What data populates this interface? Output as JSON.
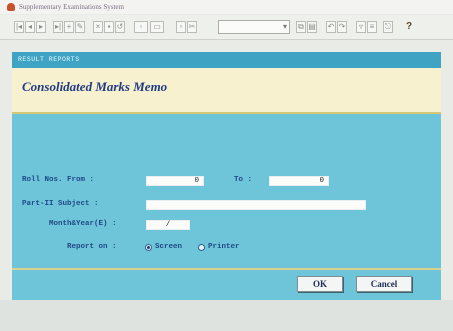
{
  "window": {
    "title": "Supplementary Examinations System"
  },
  "toolbar": {
    "button_icons": [
      "first-record-icon",
      "previous-record-icon",
      "next-record-icon",
      "last-record-icon",
      "add-icon",
      "edit-icon",
      "delete-icon",
      "save-icon",
      "cancel-icon",
      "find-icon",
      "print-icon",
      "preview-icon",
      "cut-icon",
      "copy-icon",
      "paste-icon",
      "undo-icon",
      "exit-icon"
    ],
    "combo_value": "",
    "help_label": "?"
  },
  "dialog": {
    "header": "RESULT REPORTS",
    "title": "Consolidated Marks Memo",
    "roll_from_label": "Roll Nos. From :",
    "roll_from_value": "0",
    "roll_to_label": "To :",
    "roll_to_value": "0",
    "subject_label": "Part-II Subject :",
    "subject_value": "",
    "month_year_label": "Month&Year(E) :",
    "month_year_value": "/",
    "report_on_label": "Report on :",
    "options": [
      {
        "label": "Screen",
        "selected": true
      },
      {
        "label": "Printer",
        "selected": false
      }
    ],
    "ok_label": "OK",
    "cancel_label": "Cancel"
  }
}
